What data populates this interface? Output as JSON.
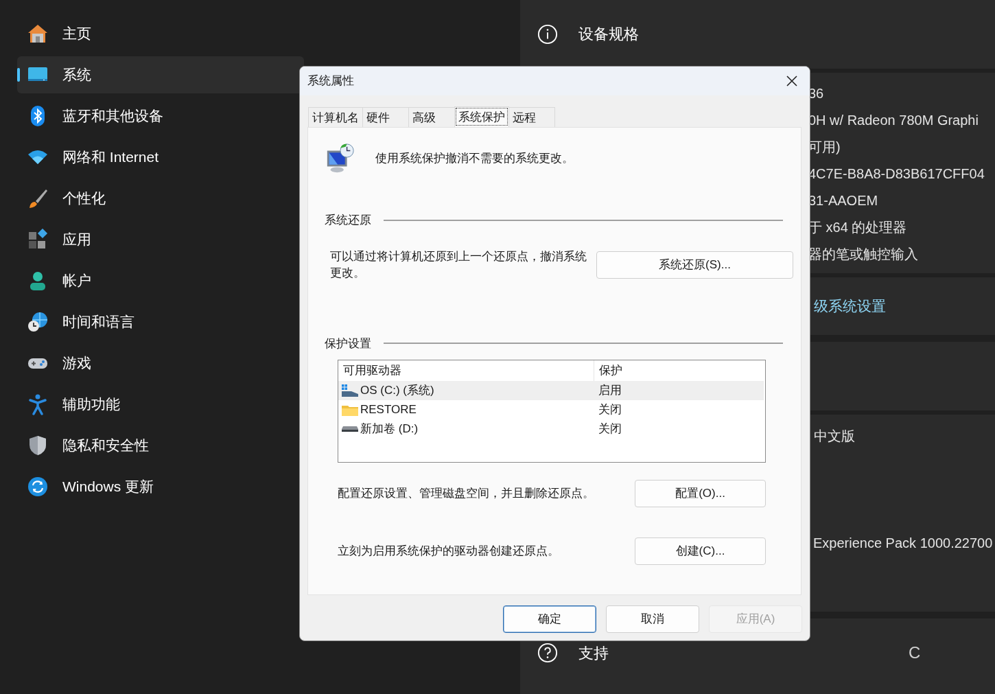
{
  "sidebar": {
    "items": [
      {
        "label": "主页",
        "selected": false
      },
      {
        "label": "系统",
        "selected": true
      },
      {
        "label": "蓝牙和其他设备",
        "selected": false
      },
      {
        "label": "网络和 Internet",
        "selected": false
      },
      {
        "label": "个性化",
        "selected": false
      },
      {
        "label": "应用",
        "selected": false
      },
      {
        "label": "帐户",
        "selected": false
      },
      {
        "label": "时间和语言",
        "selected": false
      },
      {
        "label": "游戏",
        "selected": false
      },
      {
        "label": "辅助功能",
        "selected": false
      },
      {
        "label": "隐私和安全性",
        "selected": false
      },
      {
        "label": "Windows 更新",
        "selected": false
      }
    ]
  },
  "right_panel": {
    "section_title": "设备规格",
    "spec_lines": [
      "36",
      "0H w/ Radeon 780M Graphi",
      "可用)",
      "4C7E-B8A8-D83B617CFF04",
      "31-AAOEM",
      "于 x64 的处理器",
      "器的笔或触控输入"
    ],
    "link": "级系统设置",
    "edition_line": "中文版",
    "experience_line": "Experience Pack 1000.22700",
    "support_title": "支持",
    "cut_text": "C"
  },
  "dialog": {
    "title": "系统属性",
    "tabs": [
      {
        "label": "计算机名",
        "selected": false
      },
      {
        "label": "硬件",
        "selected": false
      },
      {
        "label": "高级",
        "selected": false
      },
      {
        "label": "系统保护",
        "selected": true
      },
      {
        "label": "远程",
        "selected": false
      }
    ],
    "intro": "使用系统保护撤消不需要的系统更改。",
    "restore_section": {
      "heading": "系统还原",
      "description": "可以通过将计算机还原到上一个还原点，撤消系统更改。",
      "button": "系统还原(S)..."
    },
    "protection_section": {
      "heading": "保护设置",
      "table": {
        "columns": [
          "可用驱动器",
          "保护"
        ],
        "rows": [
          {
            "kind": "system-drive",
            "drive": "OS (C:) (系统)",
            "protection": "启用",
            "selected": true
          },
          {
            "kind": "folder",
            "drive": "RESTORE",
            "protection": "关闭",
            "selected": false
          },
          {
            "kind": "drive",
            "drive": "新加卷 (D:)",
            "protection": "关闭",
            "selected": false
          }
        ]
      },
      "configure_text": "配置还原设置、管理磁盘空间，并且删除还原点。",
      "configure_button": "配置(O)...",
      "create_text": "立刻为启用系统保护的驱动器创建还原点。",
      "create_button": "创建(C)..."
    },
    "buttons": [
      {
        "label": "确定",
        "default": true,
        "disabled": false
      },
      {
        "label": "取消",
        "default": false,
        "disabled": false
      },
      {
        "label": "应用(A)",
        "default": false,
        "disabled": true
      }
    ]
  }
}
